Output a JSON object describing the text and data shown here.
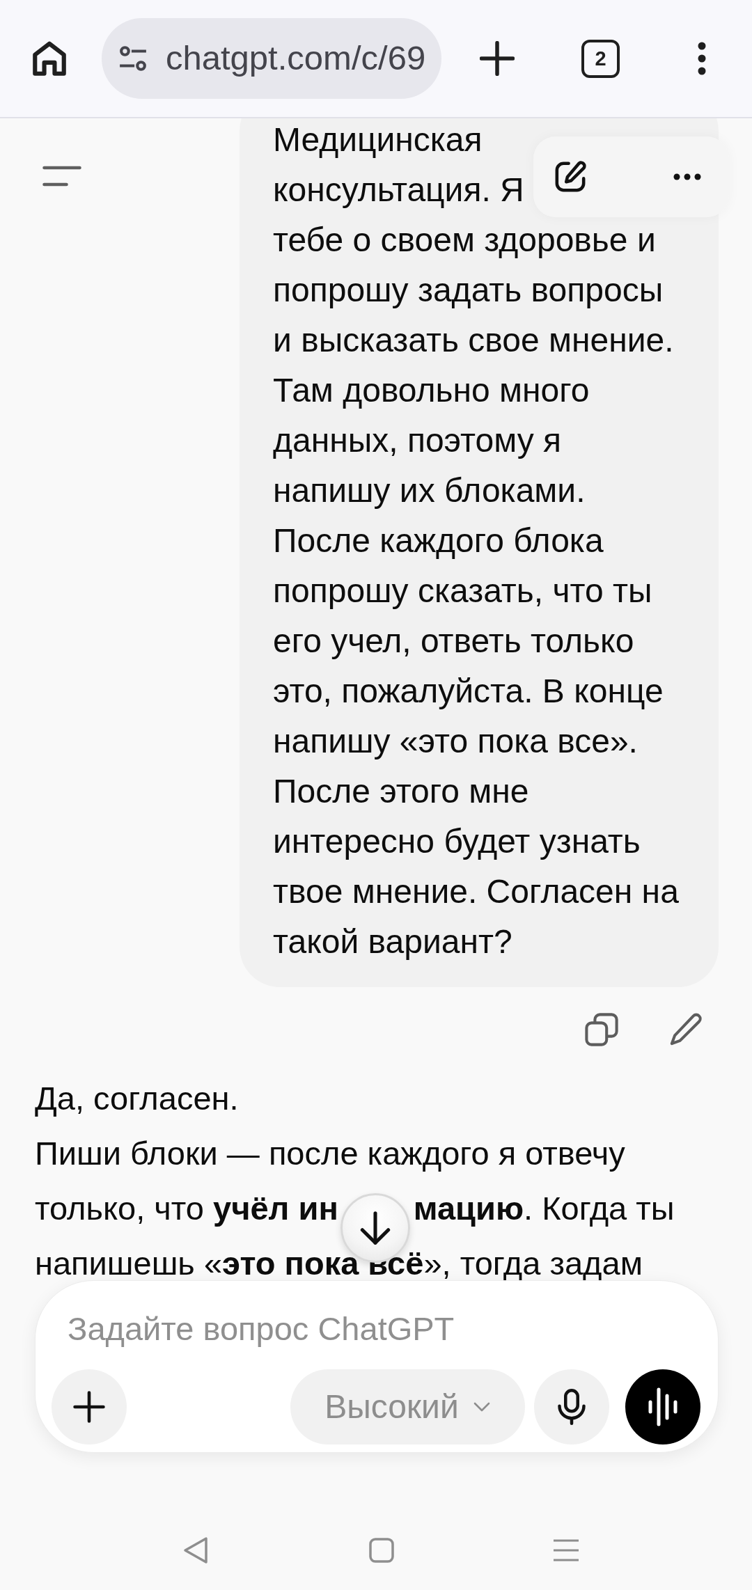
{
  "browser_bar": {
    "url": "chatgpt.com/c/69",
    "tab_count": "2"
  },
  "user_message": {
    "lines": [
      "Медицинская",
      "консультация. Я",
      "тебе о своем здоровье и",
      "попрошу задать вопросы",
      "и высказать свое мнение.",
      "Там довольно много",
      "данных, поэтому я",
      "напишу их блоками.",
      "После каждого блока",
      "попрошу сказать, что ты",
      "его учел, ответь только",
      "это, пожалуйста. В конце",
      "напишу «это пока все».",
      "После этого мне",
      "интересно будет узнать",
      "твое мнение. Согласен на",
      "такой вариант?"
    ]
  },
  "assistant_message": {
    "paragraphs": [
      {
        "lines": [
          {
            "segments": [
              "Да, согласен."
            ]
          }
        ]
      },
      {
        "lines": [
          {
            "segments": [
              "Пиши блоки — после каждого я отвечу"
            ]
          },
          {
            "segments": [
              "только, что **учёл ин**",
              "**мацию**. Когда ты"
            ]
          },
          {
            "segments": [
              "напишешь «**это пока всё**», тогда задам"
            ]
          }
        ]
      }
    ]
  },
  "composer": {
    "placeholder": "Задайте вопрос ChatGPT",
    "mode": "Высокий"
  }
}
